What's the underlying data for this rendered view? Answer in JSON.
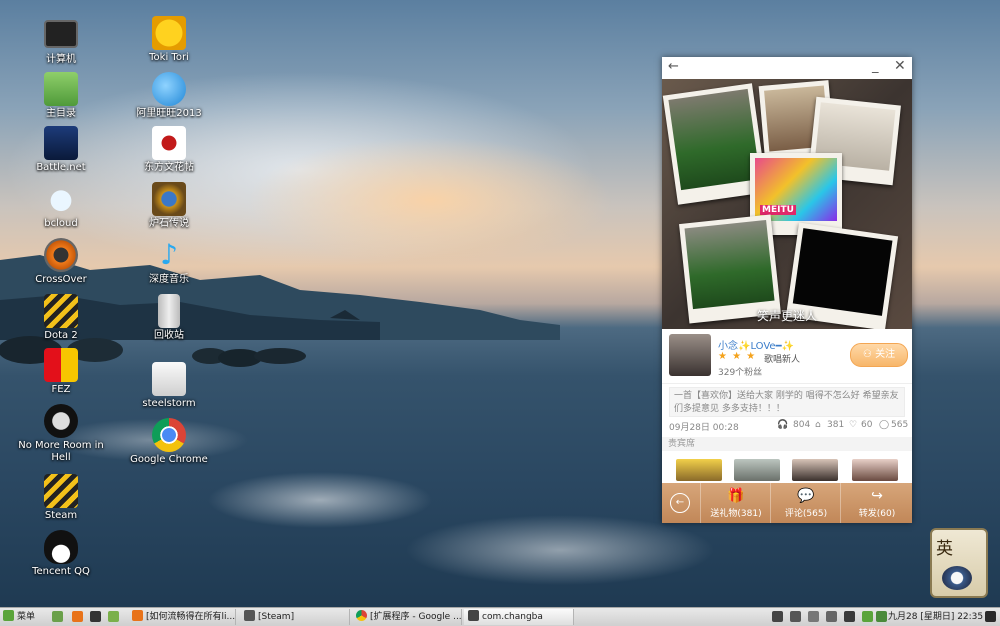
{
  "desktop": {
    "icons": [
      {
        "label": "计算机"
      },
      {
        "label": "主目录"
      },
      {
        "label": "Battle.net"
      },
      {
        "label": "bcloud"
      },
      {
        "label": "CrossOver"
      },
      {
        "label": "Dota 2"
      },
      {
        "label": "FEZ"
      },
      {
        "label": "No More Room in Hell"
      },
      {
        "label": "Steam"
      },
      {
        "label": "Tencent QQ"
      },
      {
        "label": "Toki Tori"
      },
      {
        "label": "阿里旺旺2013"
      },
      {
        "label": "东方文花帖"
      },
      {
        "label": "炉石传说"
      },
      {
        "label": "深度音乐"
      },
      {
        "label": "回收站"
      },
      {
        "label": "steelstorm"
      },
      {
        "label": "Google Chrome"
      }
    ]
  },
  "app": {
    "title_back": "←",
    "title_min": "_",
    "title_close": "✕",
    "cover_caption": "笑声更迷人",
    "cover_photo_text": "MEITU",
    "profile": {
      "username": "小念✨LOVe━✨",
      "rank": "歌唱新人",
      "fans": "329个粉丝",
      "follow_label": "关注"
    },
    "description": "一首【喜欢你】送给大家 刚学的 唱得不怎么好 希望亲友们多提意见 多多支持！！！",
    "meta": {
      "date": "09月28日 00:28",
      "listens": "804",
      "gifts": "381",
      "likes": "60",
      "comments": "565"
    },
    "guests_label": "贵宾席",
    "actions": {
      "back_icon": "←",
      "gift_label": "送礼物(381)",
      "comment_label": "评论(565)",
      "share_label": "转发(60)"
    }
  },
  "widget": {
    "text": "英"
  },
  "taskbar": {
    "menu": "菜单",
    "tasks": [
      {
        "label": "[如何流畅得在所有li..."
      },
      {
        "label": "[Steam]"
      },
      {
        "label": "[扩展程序 - Google ..."
      },
      {
        "label": "com.changba"
      }
    ],
    "clock": "九月28 [星期日] 22:35"
  }
}
